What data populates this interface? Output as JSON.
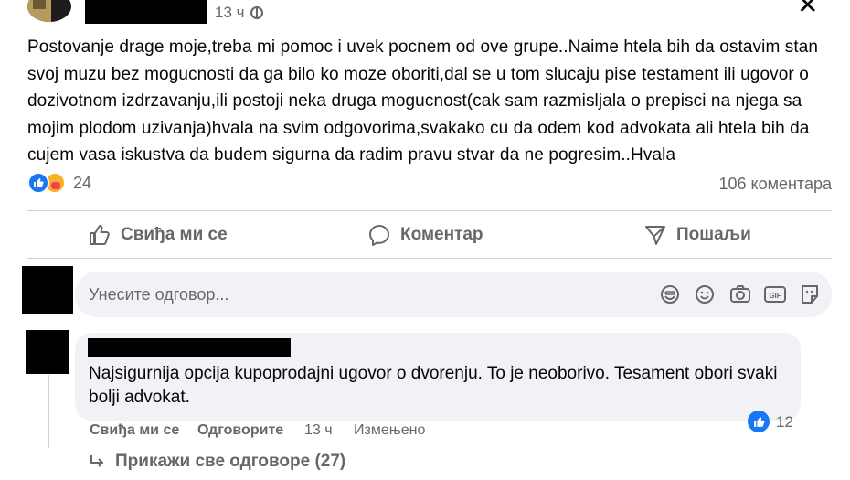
{
  "post": {
    "time": "13 ч",
    "text": "Postovanje drage moje,treba mi pomoc i uvek pocnem od ove grupe..Naime htela bih da ostavim stan svoj muzu bez mogucnosti da ga bilo ko moze oboriti,dal se u tom slucaju pise testament ili ugovor o dozivotnom izdrzavanju,ili postoji neka druga mogucnost(cak sam razmisljala o prepisci na njega sa mojim plodom uzivanja)hvala na svim odgovorima,svakako cu da odem kod advokata ali htela bih da cujem vasa iskustva da budem sigurna da radim pravu stvar da ne pogresim..Hvala",
    "reactions_count": "24",
    "comments_count": "106 коментара",
    "reaction_types": [
      "like",
      "care"
    ]
  },
  "actions": {
    "like_label": "Свиђа ми се",
    "comment_label": "Коментар",
    "share_label": "Пошаљи"
  },
  "reply_box": {
    "placeholder": "Унесите одговор...",
    "tools": [
      "sticker-icon",
      "emoji-icon",
      "camera-icon",
      "gif-icon",
      "avatar-sticker-icon"
    ]
  },
  "comment": {
    "text": "Najsigurnija opcija kupoprodajni ugovor o dvorenju. To je neoborivo. Tesament obori svaki bolji advokat.",
    "like_label": "Свиђа ми се",
    "reply_label": "Одговорите",
    "time": "13 ч",
    "edited_label": "Измењено",
    "reactions_count": "12"
  },
  "show_replies": "Прикажи све одговоре (27)",
  "colors": {
    "accent": "#1877f2",
    "secondary_text": "#65676b",
    "input_bg": "#f0f2f5",
    "divider": "#ced0d4"
  }
}
